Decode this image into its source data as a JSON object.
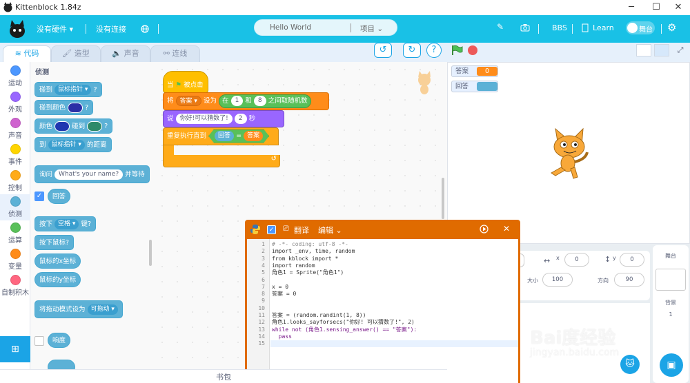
{
  "window": {
    "title": "Kittenblock 1.84z",
    "minimize": "─",
    "maximize": "☐",
    "close": "✕"
  },
  "menu": {
    "hardware": "没有硬件",
    "connect": "没有连接",
    "project_name": "Hello World",
    "project_menu": "项目",
    "bbs": "BBS",
    "learn": "Learn",
    "stage_toggle": "舞台"
  },
  "tabs": {
    "code": "代码",
    "costumes": "造型",
    "sounds": "声音",
    "connect": "连线"
  },
  "controls": {
    "help": "?"
  },
  "categories": [
    {
      "label": "运动",
      "color": "#4c97ff"
    },
    {
      "label": "外观",
      "color": "#9966ff"
    },
    {
      "label": "声音",
      "color": "#cf63cf"
    },
    {
      "label": "事件",
      "color": "#ffd500"
    },
    {
      "label": "控制",
      "color": "#ffab19"
    },
    {
      "label": "侦测",
      "color": "#5cb1d6"
    },
    {
      "label": "运算",
      "color": "#59c059"
    },
    {
      "label": "变量",
      "color": "#ff8c1a"
    },
    {
      "label": "自制积木",
      "color": "#ff6680"
    }
  ],
  "palette": {
    "heading": "侦测",
    "touching": "碰到",
    "mouse_pointer": "鼠标指针",
    "q": "?",
    "touching_color": "碰到颜色",
    "color": "颜色",
    "touches": "碰到",
    "to": "到",
    "distance": "的距离",
    "ask": "询问",
    "ask_default": "What's your name?",
    "and_wait": "并等待",
    "answer": "回答",
    "key_press": "按下",
    "space": "空格",
    "key": "键?",
    "mouse_down": "按下鼠标?",
    "mouse_x": "鼠标的x坐标",
    "mouse_y": "鼠标的y坐标",
    "drag_mode": "将拖动模式设为",
    "draggable": "可拖动",
    "loudness": "响度"
  },
  "script": {
    "when_flag": "当",
    "clicked": "被点击",
    "set": "将",
    "var": "答案",
    "set_to": "设为",
    "pick": "在",
    "n1": "1",
    "and": "和",
    "n2": "8",
    "between": "之间取随机数",
    "say": "说",
    "say_text": "你好!可以猜数了!",
    "secs": "2",
    "seconds": "秒",
    "repeat_until": "重复执行直到",
    "answer": "回答",
    "eq": "=",
    "ans_var": "答案"
  },
  "monitors": {
    "var_label": "答案",
    "var_value": "0",
    "answer_label": "回答"
  },
  "sprite_panel": {
    "x_label": "x",
    "x_value": "0",
    "y_label": "y",
    "y_value": "0",
    "size_label": "大小",
    "size_value": "100",
    "dir_label": "方向",
    "dir_value": "90",
    "stage_label": "舞台",
    "backdrop_label": "背景",
    "backdrop_value": "1"
  },
  "python": {
    "translate": "翻译",
    "edit": "编辑",
    "close": "✕",
    "lines": [
      "# -*- coding: utf-8 -*-",
      "import _env, time, random",
      "from kblock import *",
      "import random",
      "角色1 = Sprite(\"角色1\")",
      "",
      "x = 0",
      "答案 = 0",
      "",
      "",
      "答案 = (random.randint(1, 8))",
      "角色1.looks_sayforsecs(\"你好! 可以猜数了!\", 2)",
      "while not (角色1.sensing_answer() == \"答案\"):",
      "  pass",
      ""
    ],
    "line_numbers": [
      "1",
      "2",
      "3",
      "4",
      "5",
      "6",
      "7",
      "8",
      "9",
      "10",
      "11",
      "12",
      "13",
      "14",
      "15"
    ]
  },
  "bottom": {
    "backpack": "书包"
  },
  "watermark": {
    "brand": "Bai度经验",
    "url": "jingyan.baidu.com"
  }
}
